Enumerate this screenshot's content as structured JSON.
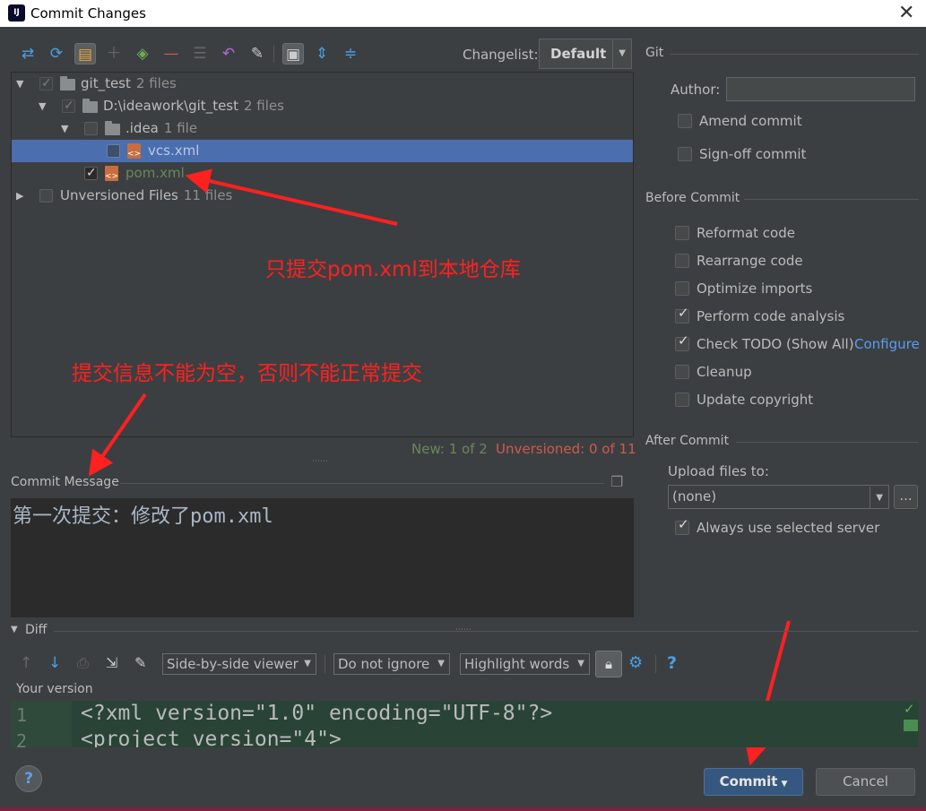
{
  "window": {
    "title": "Commit Changes"
  },
  "changelist": {
    "label": "Changelist:",
    "value": "Default"
  },
  "tree": {
    "root": {
      "name": "git_test",
      "count": "2 files"
    },
    "dir": {
      "name": "D:\\ideawork\\git_test",
      "count": "2 files"
    },
    "idea": {
      "name": ".idea",
      "count": "1 file"
    },
    "vcs": {
      "name": "vcs.xml"
    },
    "pom": {
      "name": "pom.xml"
    },
    "unversioned": {
      "name": "Unversioned Files",
      "count": "11 files"
    }
  },
  "status": {
    "new": "New: 1 of 2",
    "unversioned": "Unversioned: 0 of 11"
  },
  "annotations": {
    "a1": "只提交pom.xml到本地仓库",
    "a2": "提交信息不能为空，否则不能正常提交"
  },
  "commit_message": {
    "label": "Commit Message",
    "text": "第一次提交：修改了pom.xml"
  },
  "git": {
    "section": "Git",
    "author_label": "Author:",
    "author_value": "",
    "amend": "Amend commit",
    "signoff": "Sign-off commit"
  },
  "before_commit": {
    "section": "Before Commit",
    "reformat": "Reformat code",
    "rearrange": "Rearrange code",
    "optimize": "Optimize imports",
    "analysis": "Perform code analysis",
    "todo": "Check TODO (Show All)",
    "configure": "Configure",
    "cleanup": "Cleanup",
    "copyright": "Update copyright"
  },
  "after_commit": {
    "section": "After Commit",
    "upload_label": "Upload files to:",
    "upload_value": "(none)",
    "more": "...",
    "always": "Always use selected server"
  },
  "diff": {
    "label": "Diff",
    "viewer": "Side-by-side viewer",
    "ignore": "Do not ignore",
    "highlight": "Highlight words",
    "help": "?",
    "your_version": "Your version",
    "lines": [
      {
        "num": "1",
        "text": "<?xml version=\"1.0\" encoding=\"UTF-8\"?>"
      },
      {
        "num": "2",
        "text": "<project version=\"4\">"
      }
    ]
  },
  "buttons": {
    "help": "?",
    "commit": "Commit",
    "cancel": "Cancel"
  },
  "colors": {
    "selection": "#4b6eaf",
    "green_text": "#6a8759",
    "red_text": "#cc5b4d",
    "link": "#589df6",
    "annotation": "#ff2020"
  }
}
